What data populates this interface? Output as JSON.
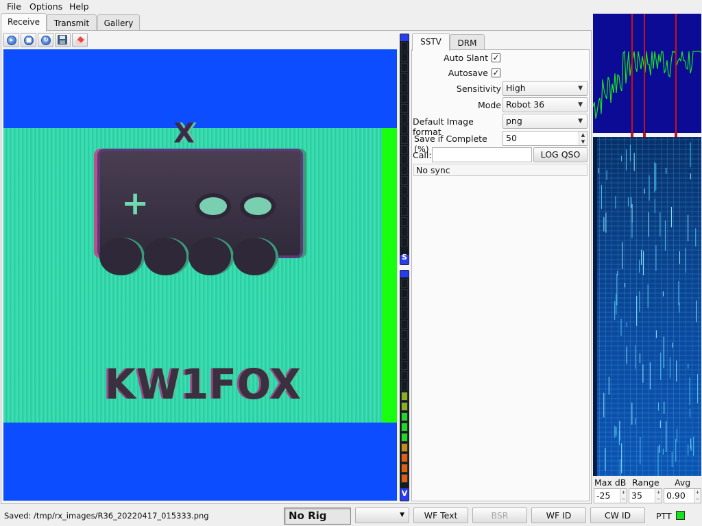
{
  "menu": {
    "file": "File",
    "options": "Options",
    "help": "Help"
  },
  "main_tabs": {
    "receive": "Receive",
    "transmit": "Transmit",
    "gallery": "Gallery"
  },
  "toolbar": {
    "start_icon": "play-icon",
    "stop_icon": "stop-icon",
    "resync_icon": "refresh-icon",
    "save_icon": "floppy-disk-icon",
    "erase_icon": "eraser-icon"
  },
  "image": {
    "callsign": "KW1FOX"
  },
  "meters": {
    "sync_label": "S",
    "volume_label": "V",
    "volume_level": 0.45
  },
  "mode_tabs": {
    "sstv": "SSTV",
    "drm": "DRM"
  },
  "sstv": {
    "auto_slant_label": "Auto Slant",
    "auto_slant_checked": "✓",
    "autosave_label": "Autosave",
    "autosave_checked": "✓",
    "sensitivity_label": "Sensitivity",
    "sensitivity_value": "High",
    "mode_label": "Mode",
    "mode_value": "Robot 36",
    "image_format_label": "Default Image format",
    "image_format_value": "png",
    "save_complete_label": "Save if Complete (%)",
    "save_complete_value": "50",
    "call_label": "Call:",
    "call_value": "",
    "log_qso_label": "LOG QSO",
    "sync_status": "No sync"
  },
  "waterfall": {
    "max_db_label": "Max dB",
    "range_label": "Range",
    "avg_label": "Avg",
    "max_db_value": "-25",
    "range_value": "35",
    "avg_value": "0.90"
  },
  "statusbar": {
    "saved_text": "Saved: /tmp/rx_images/R36_20220417_015333.png",
    "rig_text": "No Rig",
    "combo_value": "",
    "wf_text_label": "WF Text",
    "bsr_label": "BSR",
    "wf_id_label": "WF ID",
    "cw_id_label": "CW ID",
    "ptt_label": "PTT"
  },
  "colors": {
    "image_bg": "#0c4dff",
    "band": "#2fd6a8",
    "ptt_on": "#16e41b",
    "spectrum_line": "#18e818",
    "marker": "#d01010"
  }
}
